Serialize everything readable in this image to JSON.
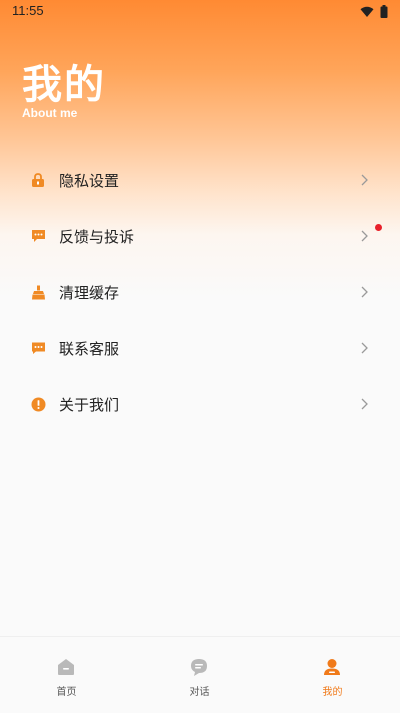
{
  "status_bar": {
    "time": "11:55"
  },
  "header": {
    "title": "我的",
    "subtitle": "About me"
  },
  "menu": [
    {
      "label": "隐私设置",
      "icon": "lock-icon"
    },
    {
      "label": "反馈与投诉",
      "icon": "feedback-icon",
      "has_notification_dot": true
    },
    {
      "label": "清理缓存",
      "icon": "broom-icon"
    },
    {
      "label": "联系客服",
      "icon": "chat-icon"
    },
    {
      "label": "关于我们",
      "icon": "info-icon"
    }
  ],
  "tabs": [
    {
      "label": "首页",
      "icon": "home-icon",
      "active": false
    },
    {
      "label": "对话",
      "icon": "dialog-icon",
      "active": false
    },
    {
      "label": "我的",
      "icon": "profile-icon",
      "active": true
    }
  ],
  "colors": {
    "accent": "#f07a1a",
    "icon": "#f08a24",
    "notification": "#e8202a"
  }
}
